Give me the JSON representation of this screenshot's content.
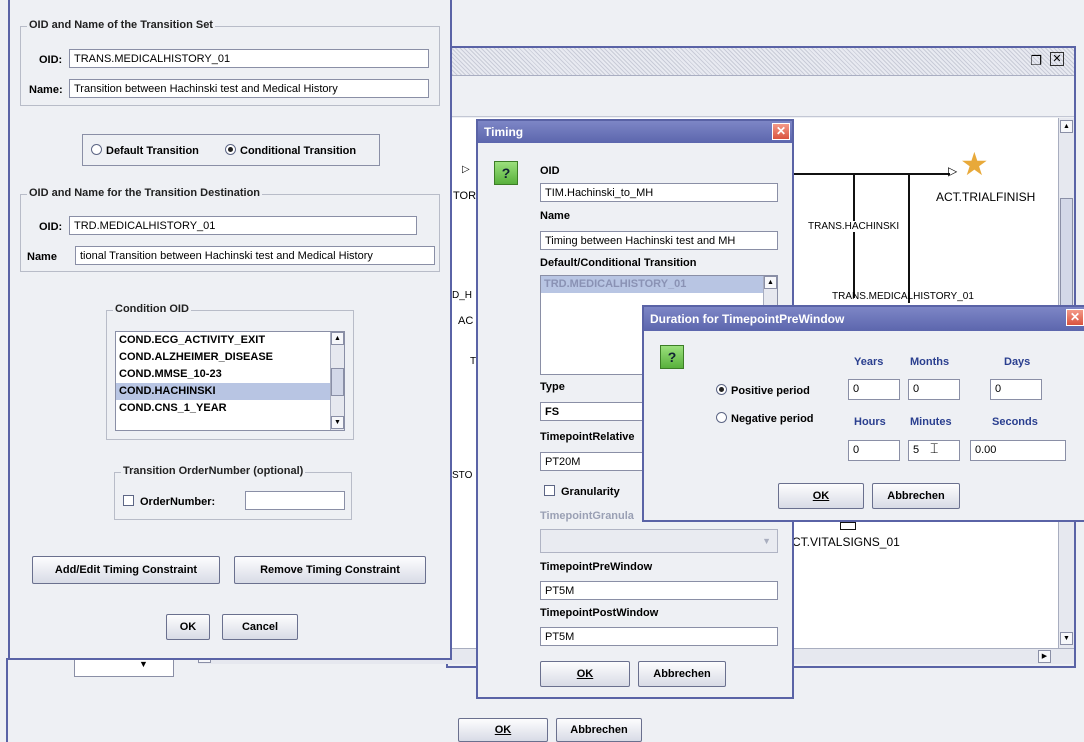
{
  "editor": {
    "labels": [
      "TOR",
      "D_H",
      "AC",
      "STO",
      "T"
    ],
    "nodes": {
      "trialfinish": "ACT.TRIALFINISH",
      "trans_hachinski": "TRANS.HACHINSKI",
      "trans_medical": "TRANS.MEDICALHISTORY_01",
      "vitalsigns": "CT.VITALSIGNS_01"
    },
    "window_icons": [
      "restore-icon",
      "close-icon"
    ]
  },
  "transition_set": {
    "legend": "OID and Name of the Transition Set",
    "oid_label": "OID:",
    "oid_value": "TRANS.MEDICALHISTORY_01",
    "name_label": "Name:",
    "name_value": "Transition between Hachinski test and Medical History",
    "type_default": "Default Transition",
    "type_conditional": "Conditional Transition",
    "dest_legend": "OID and Name for the Transition Destination",
    "dest_oid_label": "OID:",
    "dest_oid_value": "TRD.MEDICALHISTORY_01",
    "dest_name_label": "Name",
    "dest_name_value": "tional Transition between Hachinski test and Medical History",
    "condition_legend": "Condition OID",
    "conditions": [
      "COND.ECG_ACTIVITY_EXIT",
      "COND.ALZHEIMER_DISEASE",
      "COND.MMSE_10-23",
      "COND.HACHINSKI",
      "COND.CNS_1_YEAR"
    ],
    "selected_condition": "COND.HACHINSKI",
    "order_legend": "Transition OrderNumber (optional)",
    "order_label": "OrderNumber:",
    "order_value": "",
    "add_timing": "Add/Edit Timing Constraint",
    "remove_timing": "Remove Timing Constraint",
    "ok": "OK",
    "cancel": "Cancel"
  },
  "timing": {
    "title": "Timing",
    "oid_label": "OID",
    "oid_value": "TIM.Hachinski_to_MH",
    "name_label": "Name",
    "name_value": "Timing between Hachinski test and MH",
    "dc_label": "Default/Conditional Transition",
    "dc_item": "TRD.MEDICALHISTORY_01",
    "type_label": "Type",
    "type_value": "FS",
    "relative_label": "TimepointRelative",
    "relative_value": "PT20M",
    "granularity_label": "Granularity",
    "granularity_field_label": "TimepointGranula",
    "prewindow_label": "TimepointPreWindow",
    "prewindow_value": "PT5M",
    "postwindow_label": "TimepointPostWindow",
    "postwindow_value": "PT5M",
    "ok": "OK",
    "cancel": "Abbrechen"
  },
  "duration": {
    "title": "Duration for TimepointPreWindow",
    "positive": "Positive period",
    "negative": "Negative period",
    "years_label": "Years",
    "months_label": "Months",
    "days_label": "Days",
    "hours_label": "Hours",
    "minutes_label": "Minutes",
    "seconds_label": "Seconds",
    "years": "0",
    "months": "0",
    "days": "0",
    "hours": "0",
    "minutes": "5",
    "seconds": "0.00",
    "ok": "OK",
    "cancel": "Abbrechen"
  },
  "bottom": {
    "ok": "OK",
    "cancel": "Abbrechen"
  },
  "colors": {
    "window_border": "#5a63a6",
    "title_bar": "#6b74b8",
    "close_button": "#e06048",
    "selection": "#b8c5e3",
    "help_icon": "#6cc04a"
  }
}
